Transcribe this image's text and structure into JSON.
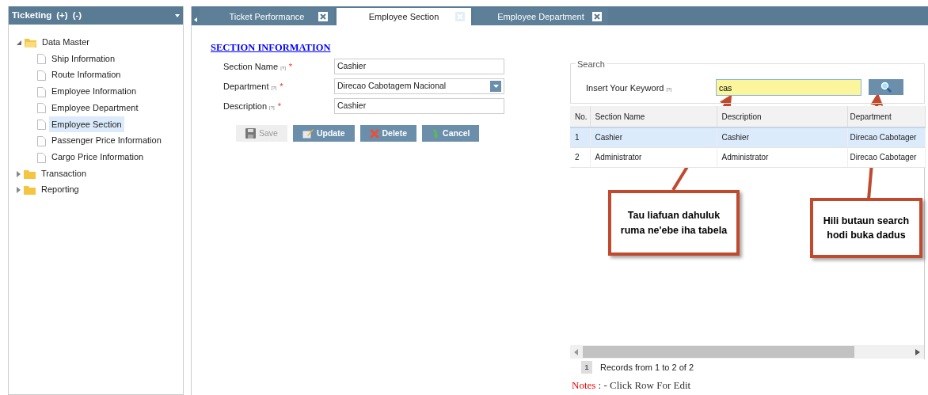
{
  "sidebar": {
    "title": "Ticketing",
    "actions": [
      "(+)",
      "(-)"
    ],
    "tree": [
      {
        "label": "Data Master",
        "expanded": true,
        "children": [
          {
            "label": "Ship Information",
            "selected": false
          },
          {
            "label": "Route Information",
            "selected": false
          },
          {
            "label": "Employee Information",
            "selected": false
          },
          {
            "label": "Employee Department",
            "selected": false
          },
          {
            "label": "Employee Section",
            "selected": true
          },
          {
            "label": "Passenger Price Information",
            "selected": false
          },
          {
            "label": "Cargo Price Information",
            "selected": false
          }
        ]
      },
      {
        "label": "Transaction",
        "expanded": false
      },
      {
        "label": "Reporting",
        "expanded": false
      }
    ]
  },
  "tabs": [
    {
      "label": "Ticket Performance",
      "selected": false
    },
    {
      "label": "Employee Section",
      "selected": true
    },
    {
      "label": "Employee Department",
      "selected": false
    }
  ],
  "form": {
    "heading": "SECTION INFORMATION",
    "fields": [
      {
        "kind": "text",
        "label": "Section Name",
        "hint": "[?]",
        "required_mark": "*",
        "value": "Cashier"
      },
      {
        "kind": "select",
        "label": "Department",
        "hint": "[?]",
        "required_mark": "*",
        "value": "Direcao Cabotagem Nacional"
      },
      {
        "kind": "text",
        "label": "Description",
        "hint": "[?]",
        "required_mark": "*",
        "value": "Cashier"
      }
    ],
    "buttons": [
      {
        "kind": "save",
        "label": "Save",
        "disabled": true
      },
      {
        "kind": "update",
        "label": "Update",
        "disabled": false
      },
      {
        "kind": "delete",
        "label": "Delete",
        "disabled": false
      },
      {
        "kind": "cancel",
        "label": "Cancel",
        "disabled": false
      }
    ]
  },
  "search": {
    "legend": "Search",
    "label": "Insert Your Keyword",
    "hint": "[?]",
    "value": "cas"
  },
  "grid": {
    "columns": [
      "No.",
      "Section Name",
      "Description",
      "Department"
    ],
    "rows": [
      {
        "selected": true,
        "cells": [
          "1",
          "Cashier",
          "Cashier",
          "Direcao Cabotager"
        ]
      },
      {
        "selected": false,
        "cells": [
          "2",
          "Administrator",
          "Administrator",
          "Direcao Cabotager"
        ]
      }
    ],
    "pager": {
      "page": "1",
      "summary": "Records from 1 to 2 of 2"
    }
  },
  "notes": {
    "label": "Notes",
    "text": ": - Click Row For Edit"
  },
  "callouts": [
    {
      "text": "Tau liafuan dahuluk ruma ne'ebe iha tabela"
    },
    {
      "text": "Hili butaun search hodi buka dadus"
    }
  ]
}
